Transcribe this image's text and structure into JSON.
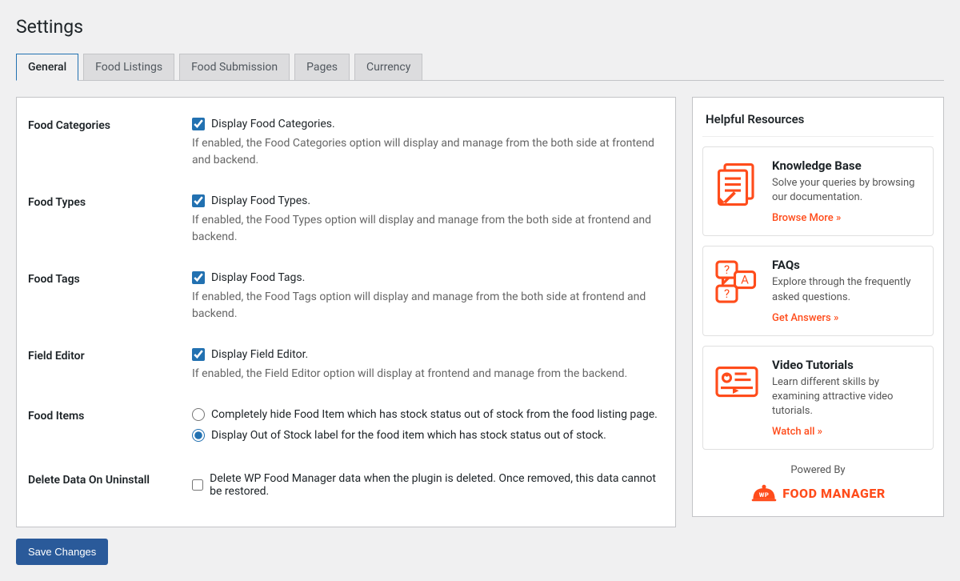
{
  "page_title": "Settings",
  "tabs": [
    {
      "label": "General",
      "active": true
    },
    {
      "label": "Food Listings",
      "active": false
    },
    {
      "label": "Food Submission",
      "active": false
    },
    {
      "label": "Pages",
      "active": false
    },
    {
      "label": "Currency",
      "active": false
    }
  ],
  "settings": {
    "food_categories": {
      "section": "Food Categories",
      "checkbox_label": "Display Food Categories.",
      "checked": true,
      "description": "If enabled, the Food Categories option will display and manage from the both side at frontend and backend."
    },
    "food_types": {
      "section": "Food Types",
      "checkbox_label": "Display Food Types.",
      "checked": true,
      "description": "If enabled, the Food Types option will display and manage from the both side at frontend and backend."
    },
    "food_tags": {
      "section": "Food Tags",
      "checkbox_label": "Display Food Tags.",
      "checked": true,
      "description": "If enabled, the Food Tags option will display and manage from the both side at frontend and backend."
    },
    "field_editor": {
      "section": "Field Editor",
      "checkbox_label": "Display Field Editor.",
      "checked": true,
      "description": "If enabled, the Field Editor option will display at frontend and manage from the backend."
    },
    "food_items": {
      "section": "Food Items",
      "options": [
        {
          "label": "Completely hide Food Item which has stock status out of stock from the food listing page.",
          "selected": false
        },
        {
          "label": "Display Out of Stock label for the food item which has stock status out of stock.",
          "selected": true
        }
      ]
    },
    "delete_data": {
      "section": "Delete Data On Uninstall",
      "checkbox_label": "Delete WP Food Manager data when the plugin is deleted. Once removed, this data cannot be restored.",
      "checked": false
    }
  },
  "save_button": "Save Changes",
  "sidebar": {
    "title": "Helpful Resources",
    "resources": [
      {
        "title": "Knowledge Base",
        "desc": "Solve your queries by browsing our documentation.",
        "link": "Browse More »"
      },
      {
        "title": "FAQs",
        "desc": "Explore through the frequently asked questions.",
        "link": "Get Answers »"
      },
      {
        "title": "Video Tutorials",
        "desc": "Learn different skills by examining attractive video tutorials.",
        "link": "Watch all »"
      }
    ],
    "powered_by": "Powered By",
    "brand_prefix": "WP",
    "brand_name": "FOOD MANAGER"
  }
}
